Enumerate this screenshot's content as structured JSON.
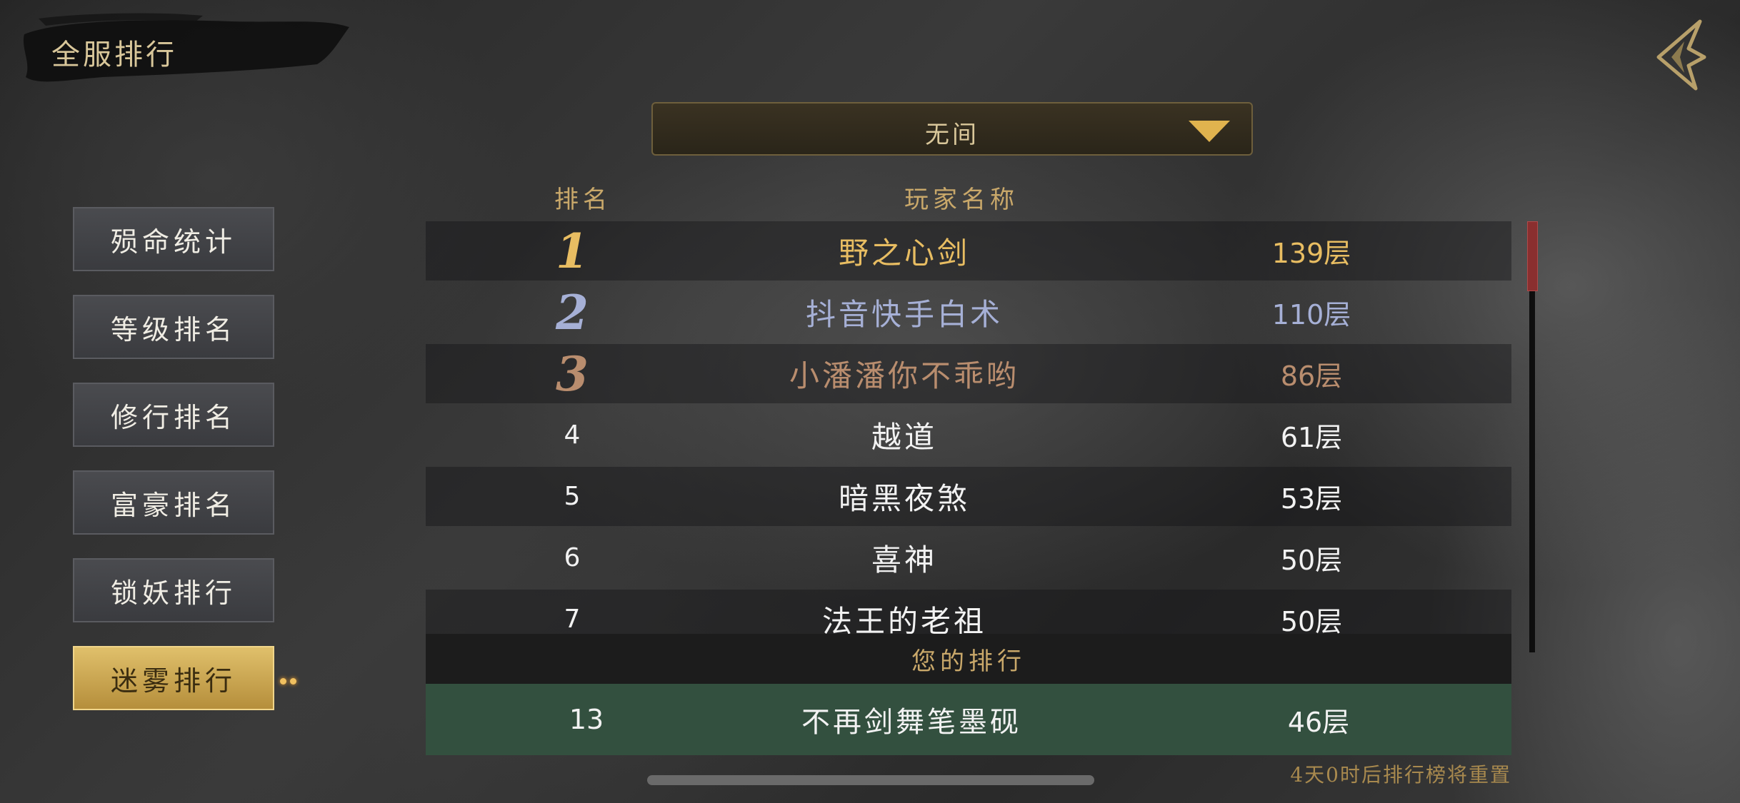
{
  "header": {
    "title": "全服排行"
  },
  "dropdown": {
    "selected": "无间"
  },
  "columns": {
    "rank": "排名",
    "player": "玩家名称"
  },
  "sidebar": {
    "items": [
      {
        "label": "殒命统计"
      },
      {
        "label": "等级排名"
      },
      {
        "label": "修行排名"
      },
      {
        "label": "富豪排名"
      },
      {
        "label": "锁妖排行"
      },
      {
        "label": "迷雾排行",
        "active": true
      }
    ]
  },
  "rankings": [
    {
      "rank": "1",
      "name": "野之心剑",
      "score": "139层"
    },
    {
      "rank": "2",
      "name": "抖音快手白术",
      "score": "110层"
    },
    {
      "rank": "3",
      "name": "小潘潘你不乖哟",
      "score": "86层"
    },
    {
      "rank": "4",
      "name": "越道",
      "score": "61层"
    },
    {
      "rank": "5",
      "name": "暗黑夜煞",
      "score": "53层"
    },
    {
      "rank": "6",
      "name": "喜神",
      "score": "50层"
    },
    {
      "rank": "7",
      "name": "法王的老祖",
      "score": "50层"
    }
  ],
  "my_rank": {
    "header": "您的排行",
    "rank": "13",
    "name": "不再剑舞笔墨砚",
    "score": "46层"
  },
  "footer": {
    "reset_note": "4天0时后排行榜将重置"
  },
  "colors": {
    "gold": "#e8bd62",
    "silver": "#a6b0d6",
    "bronze": "#b98d6e",
    "my_row_bg": "#33503f",
    "active_tab": "#d4b15a"
  },
  "icons": {
    "back": "back-arrow-icon",
    "dropdown": "dropdown-triangle-icon"
  }
}
